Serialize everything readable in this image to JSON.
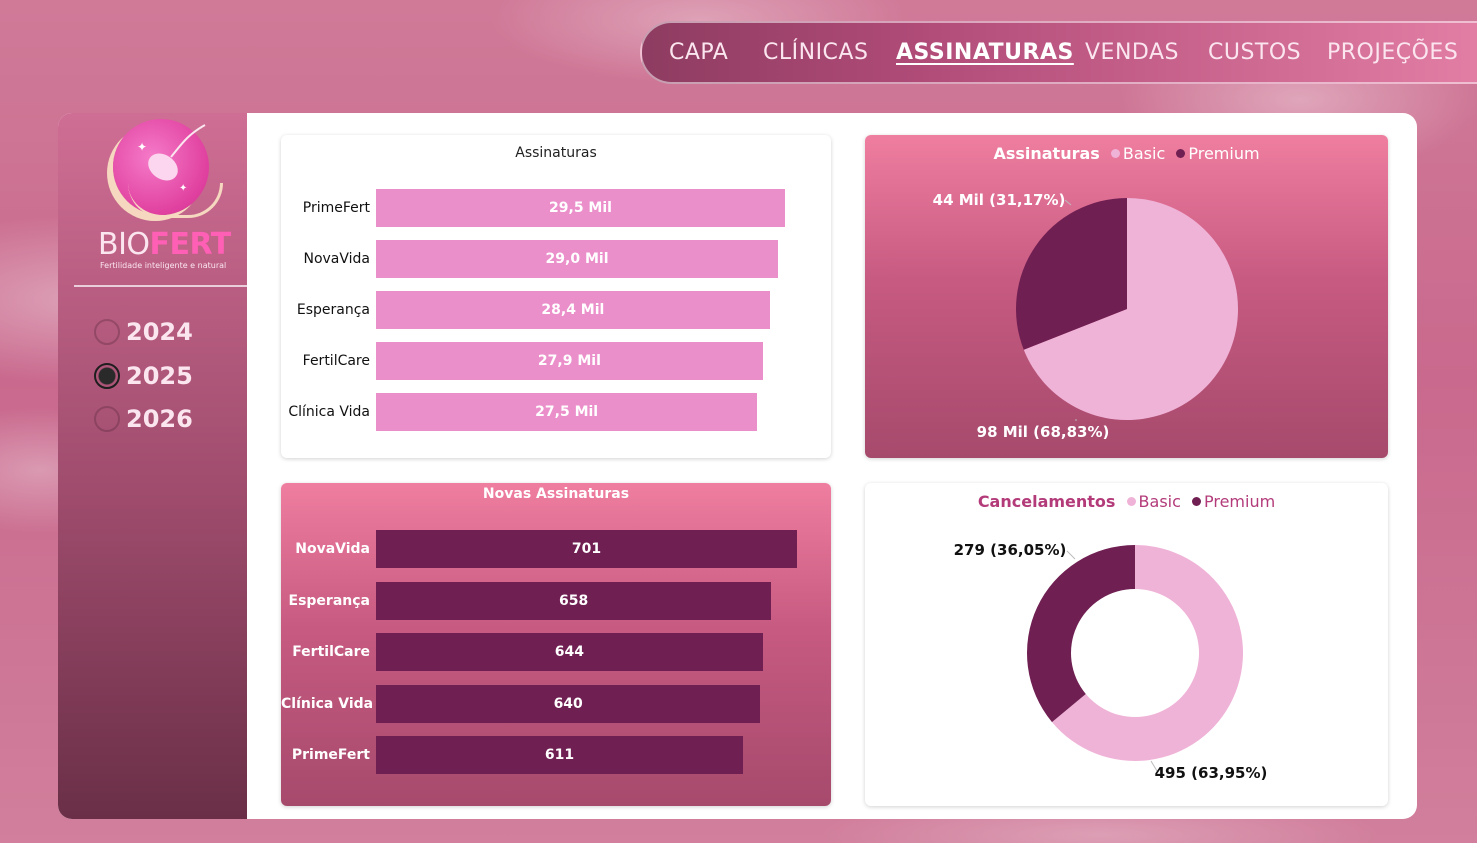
{
  "nav": {
    "items": [
      "CAPA",
      "CLÍNICAS",
      "ASSINATURAS",
      "VENDAS",
      "CUSTOS",
      "PROJEÇÕES"
    ],
    "active": "ASSINATURAS"
  },
  "brand": {
    "name_part1": "BIO",
    "name_part2": "FERT",
    "tagline": "Fertilidade inteligente e natural"
  },
  "year_filter": {
    "options": [
      "2024",
      "2025",
      "2026"
    ],
    "selected": "2025"
  },
  "colors": {
    "basic": "#f0b3d8",
    "premium": "#701f52",
    "bar_light": "#eb8fcb",
    "bar_dark": "#701f52",
    "accent": "#b33b7a"
  },
  "subscriptions_chart": {
    "title": "Assinaturas",
    "categories": [
      "PrimeFert",
      "NovaVida",
      "Esperança",
      "FertilCare",
      "Clínica Vida"
    ],
    "values": [
      29500,
      29000,
      28400,
      27900,
      27500
    ],
    "labels": [
      "29,5 Mil",
      "29,0 Mil",
      "28,4 Mil",
      "27,9 Mil",
      "27,5 Mil"
    ]
  },
  "new_subscriptions_chart": {
    "title": "Novas Assinaturas",
    "categories": [
      "NovaVida",
      "Esperança",
      "FertilCare",
      "Clínica Vida",
      "PrimeFert"
    ],
    "values": [
      701,
      658,
      644,
      640,
      611
    ],
    "labels": [
      "701",
      "658",
      "644",
      "640",
      "611"
    ]
  },
  "subscriptions_pie": {
    "title": "Assinaturas",
    "legend": [
      "Basic",
      "Premium"
    ],
    "values": [
      98000,
      44000
    ],
    "percent": [
      68.83,
      31.17
    ],
    "labels": [
      "98 Mil (68,83%)",
      "44 Mil (31,17%)"
    ]
  },
  "cancellations_donut": {
    "title": "Cancelamentos",
    "legend": [
      "Basic",
      "Premium"
    ],
    "values": [
      495,
      279
    ],
    "percent": [
      63.95,
      36.05
    ],
    "labels": [
      "495 (63,95%)",
      "279 (36,05%)"
    ]
  },
  "chart_data": [
    {
      "type": "bar",
      "title": "Assinaturas",
      "categories": [
        "PrimeFert",
        "NovaVida",
        "Esperança",
        "FertilCare",
        "Clínica Vida"
      ],
      "values": [
        29500,
        29000,
        28400,
        27900,
        27500
      ]
    },
    {
      "type": "bar",
      "title": "Novas Assinaturas",
      "categories": [
        "NovaVida",
        "Esperança",
        "FertilCare",
        "Clínica Vida",
        "PrimeFert"
      ],
      "values": [
        701,
        658,
        644,
        640,
        611
      ]
    },
    {
      "type": "pie",
      "title": "Assinaturas",
      "categories": [
        "Basic",
        "Premium"
      ],
      "values": [
        98000,
        44000
      ]
    },
    {
      "type": "pie",
      "title": "Cancelamentos",
      "categories": [
        "Basic",
        "Premium"
      ],
      "values": [
        495,
        279
      ]
    }
  ]
}
